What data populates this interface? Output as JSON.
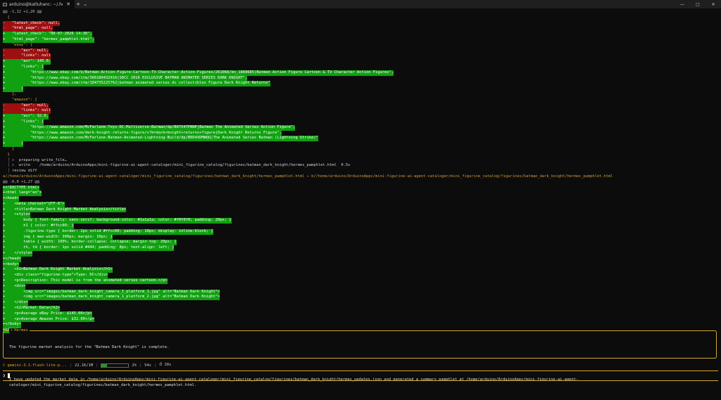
{
  "window": {
    "tab_title": "arduino@katluhanc: ~/.hermes",
    "close_glyph": "✕",
    "new_tab_glyph": "+",
    "dropdown_glyph": "⌄",
    "minimize_glyph": "—",
    "maximize_glyph": "▢",
    "win_close_glyph": "✕"
  },
  "terminal": {
    "lines": [
      {
        "t": "hunk",
        "text": "@@ -1,12 +1,20 @@"
      },
      {
        "t": "ctx",
        "text": "  {"
      },
      {
        "t": "del",
        "text": "-   \"latest_check\": null,"
      },
      {
        "t": "del",
        "text": "-   \"html_page\": null,"
      },
      {
        "t": "add",
        "text": "+   \"latest_check\": \"06-07-2026 14:30\","
      },
      {
        "t": "add",
        "text": "+   \"html_page\": \"hermes_pamphlet.html\","
      },
      {
        "t": "ctx",
        "text": "    \"ebay\": {"
      },
      {
        "t": "del",
        "text": "-       \"avr\": null,"
      },
      {
        "t": "del",
        "text": "-       \"links\": null"
      },
      {
        "t": "add",
        "text": "+       \"avr\": 145.0,"
      },
      {
        "t": "add",
        "text": "+       \"links\": ["
      },
      {
        "t": "add",
        "text": "+           \"https://www.ebay.com/b/Batman-Action-Figure-Cartoon-TV-Character-Action-Figures/261068/bn_1889685|Batman Action Figure Cartoon & TV Character Action Figures\","
      },
      {
        "t": "add",
        "text": "+           \"https://www.ebay.com/itm/366180432016|SDCC 2016 EXCLUSIVE BATMAN ANIMATED SERIES DARK KNIGHT\","
      },
      {
        "t": "add",
        "text": "+           \"https://www.ebay.com/itm/184735225762|batman animated series dc collectibles Figure Dark Knight Returns\""
      },
      {
        "t": "add",
        "text": "+       ]"
      },
      {
        "t": "ctx",
        "text": "    },"
      },
      {
        "t": "ctx",
        "text": "    \"amazon\": {"
      },
      {
        "t": "del",
        "text": "-       \"avr\": null,"
      },
      {
        "t": "del",
        "text": "-       \"links\": null"
      },
      {
        "t": "add",
        "text": "+       \"avr\": 32.0,"
      },
      {
        "t": "add",
        "text": "+       \"links\": ["
      },
      {
        "t": "add",
        "text": "+           \"https://www.amazon.com/McFarlane-Toys-DC-Multiverse-Batman/dp/B07V4TPNNP|Batman The Animated Series Action Figure\","
      },
      {
        "t": "add",
        "text": "+           \"https://www.amazon.com/dark-knight-returns-figure/s?k=dark+knight+returns+figure|Dark Knight Returns Figure\","
      },
      {
        "t": "add",
        "text": "+           \"https://www.amazon.com/McFarlane-Batman-Animated-Lightning-Build/dp/B0D4XDMWQQ|The Animated Series Batman (Lightning Strike)\""
      },
      {
        "t": "add",
        "text": "+       ]"
      },
      {
        "t": "ctx",
        "text": "    }"
      },
      {
        "t": "ctx",
        "text": "  }"
      },
      {
        "t": "step",
        "text": "  ┊ ✍  preparing write_file…"
      },
      {
        "t": "step",
        "text": "  ┊ ✍  write    /home/arduino/ArduinoApps/mini-figurine-ai-agent-cataloger/mini_figurine_catalog/figurines/batman_dark_knight/hermes_pamphlet.html  0.5s"
      },
      {
        "t": "step",
        "text": "  ┊ review diff"
      },
      {
        "t": "path",
        "text": "a//home/arduino/ArduinoApps/mini-figurine-ai-agent-cataloger/mini_figurine_catalog/figurines/batman_dark_knight/hermes_pamphlet.html → b//home/arduino/ArduinoApps/mini-figurine-ai-agent-cataloger/mini_figurine_catalog/figurines/batman_dark_knight/hermes_pamphlet.html"
      },
      {
        "t": "hunk",
        "text": "@@ -0,0 +1,27 @@"
      },
      {
        "t": "add",
        "text": "+<!DOCTYPE html>"
      },
      {
        "t": "add",
        "text": "+<html lang=\"en\">"
      },
      {
        "t": "add",
        "text": "+<head>"
      },
      {
        "t": "add",
        "text": "+    <meta charset=\"UTF-8\">"
      },
      {
        "t": "add",
        "text": "+    <title>Batman Dark Knight Market Analysis</title>"
      },
      {
        "t": "add",
        "text": "+    <style>"
      },
      {
        "t": "add",
        "text": "+        body { font-family: sans-serif; background-color: #1a1a1a; color: #f0f0f0; padding: 20px; }"
      },
      {
        "t": "add",
        "text": "+        h1 { color: #ffcc00; }"
      },
      {
        "t": "add",
        "text": "+        .figurine-type { border: 2px solid #ffcc00; padding: 10px; display: inline-block; }"
      },
      {
        "t": "add",
        "text": "+        img { max-width: 300px; margin: 10px; }"
      },
      {
        "t": "add",
        "text": "+        table { width: 100%; border-collapse: collapse; margin-top: 20px; }"
      },
      {
        "t": "add",
        "text": "+        th, td { border: 1px solid #444; padding: 8px; text-align: left; }"
      },
      {
        "t": "add",
        "text": "+    </style>"
      },
      {
        "t": "add",
        "text": "+</head>"
      },
      {
        "t": "add",
        "text": "+<body>"
      },
      {
        "t": "add",
        "text": "+    <h1>Batman Dark Knight Market Analysis</h1>"
      },
      {
        "t": "add",
        "text": "+    <div class=\"figurine-type\">Type: DC</div>"
      },
      {
        "t": "add",
        "text": "+    <p>Description: This model is from the animated series cartoon.</p>"
      },
      {
        "t": "add",
        "text": "+    <div>"
      },
      {
        "t": "add",
        "text": "+        <img src=\"images/batman_dark_knight_camera_1_platform_1.jpg\" alt=\"Batman Dark Knight\">"
      },
      {
        "t": "add",
        "text": "+        <img src=\"images/batman_dark_knight_camera_1_platform_2.jpg\" alt=\"Batman Dark Knight\">"
      },
      {
        "t": "add",
        "text": "+    </div>"
      },
      {
        "t": "add",
        "text": "+    <h2>Market Data</h2>"
      },
      {
        "t": "add",
        "text": "+    <p>Average eBay Price: $145.00</p>"
      },
      {
        "t": "add",
        "text": "+    <p>Average Amazon Price: $32.00</p>"
      },
      {
        "t": "add",
        "text": "+</body>"
      },
      {
        "t": "add",
        "text": "+</html>"
      }
    ]
  },
  "response": {
    "agent_name": "Hermes",
    "line1": "The figurine market analysis for the \"Batman Dark Knight\" is complete.",
    "line2": "I have updated the market data in /home/arduino/ArduinoApps/mini-figurine-ai-agent-cataloger/mini_figurine_catalog/figurines/batman_dark_knight/hermes_updates.json and generated a summary pamphlet at /home/arduino/ArduinoApps/mini-figurine-ai-agent-cataloger/mini_figurine_catalog/figurines/batman_dark_knight/hermes_pamphlet.html."
  },
  "status": {
    "model": "⚕ gemini-3.1-flash-lite-p...",
    "tokens": "22.1K/1M",
    "context_percent_label": "2%",
    "context_fraction": 0.02,
    "elapsed": "54s",
    "timer": "⏱ 28s"
  },
  "prompt": {
    "symbol": "❯"
  },
  "colors": {
    "deletion_bg": "#9e0f0f",
    "addition_bg": "#10a010",
    "accent": "#d4a72c"
  }
}
